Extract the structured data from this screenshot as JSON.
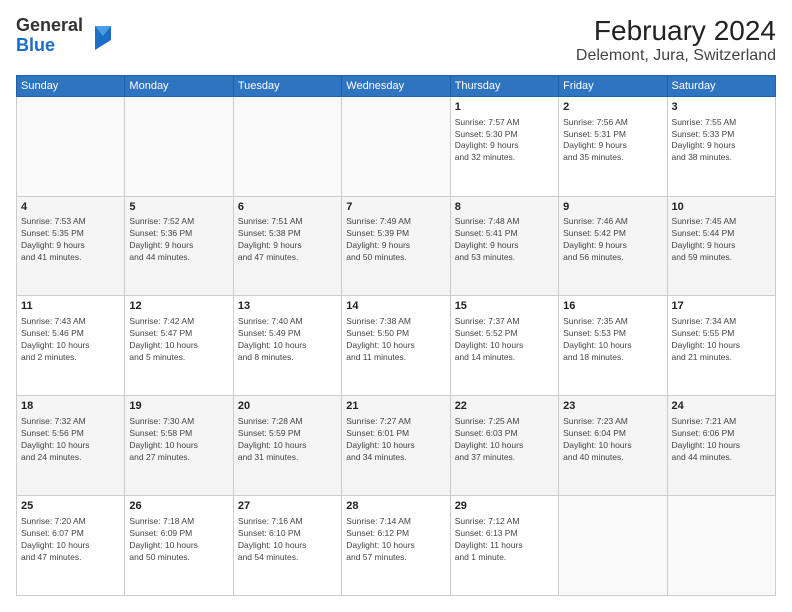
{
  "header": {
    "logo_line1": "General",
    "logo_line2": "Blue",
    "title": "February 2024",
    "subtitle": "Delemont, Jura, Switzerland"
  },
  "weekdays": [
    "Sunday",
    "Monday",
    "Tuesday",
    "Wednesday",
    "Thursday",
    "Friday",
    "Saturday"
  ],
  "weeks": [
    [
      {
        "day": "",
        "info": ""
      },
      {
        "day": "",
        "info": ""
      },
      {
        "day": "",
        "info": ""
      },
      {
        "day": "",
        "info": ""
      },
      {
        "day": "1",
        "info": "Sunrise: 7:57 AM\nSunset: 5:30 PM\nDaylight: 9 hours\nand 32 minutes."
      },
      {
        "day": "2",
        "info": "Sunrise: 7:56 AM\nSunset: 5:31 PM\nDaylight: 9 hours\nand 35 minutes."
      },
      {
        "day": "3",
        "info": "Sunrise: 7:55 AM\nSunset: 5:33 PM\nDaylight: 9 hours\nand 38 minutes."
      }
    ],
    [
      {
        "day": "4",
        "info": "Sunrise: 7:53 AM\nSunset: 5:35 PM\nDaylight: 9 hours\nand 41 minutes."
      },
      {
        "day": "5",
        "info": "Sunrise: 7:52 AM\nSunset: 5:36 PM\nDaylight: 9 hours\nand 44 minutes."
      },
      {
        "day": "6",
        "info": "Sunrise: 7:51 AM\nSunset: 5:38 PM\nDaylight: 9 hours\nand 47 minutes."
      },
      {
        "day": "7",
        "info": "Sunrise: 7:49 AM\nSunset: 5:39 PM\nDaylight: 9 hours\nand 50 minutes."
      },
      {
        "day": "8",
        "info": "Sunrise: 7:48 AM\nSunset: 5:41 PM\nDaylight: 9 hours\nand 53 minutes."
      },
      {
        "day": "9",
        "info": "Sunrise: 7:46 AM\nSunset: 5:42 PM\nDaylight: 9 hours\nand 56 minutes."
      },
      {
        "day": "10",
        "info": "Sunrise: 7:45 AM\nSunset: 5:44 PM\nDaylight: 9 hours\nand 59 minutes."
      }
    ],
    [
      {
        "day": "11",
        "info": "Sunrise: 7:43 AM\nSunset: 5:46 PM\nDaylight: 10 hours\nand 2 minutes."
      },
      {
        "day": "12",
        "info": "Sunrise: 7:42 AM\nSunset: 5:47 PM\nDaylight: 10 hours\nand 5 minutes."
      },
      {
        "day": "13",
        "info": "Sunrise: 7:40 AM\nSunset: 5:49 PM\nDaylight: 10 hours\nand 8 minutes."
      },
      {
        "day": "14",
        "info": "Sunrise: 7:38 AM\nSunset: 5:50 PM\nDaylight: 10 hours\nand 11 minutes."
      },
      {
        "day": "15",
        "info": "Sunrise: 7:37 AM\nSunset: 5:52 PM\nDaylight: 10 hours\nand 14 minutes."
      },
      {
        "day": "16",
        "info": "Sunrise: 7:35 AM\nSunset: 5:53 PM\nDaylight: 10 hours\nand 18 minutes."
      },
      {
        "day": "17",
        "info": "Sunrise: 7:34 AM\nSunset: 5:55 PM\nDaylight: 10 hours\nand 21 minutes."
      }
    ],
    [
      {
        "day": "18",
        "info": "Sunrise: 7:32 AM\nSunset: 5:56 PM\nDaylight: 10 hours\nand 24 minutes."
      },
      {
        "day": "19",
        "info": "Sunrise: 7:30 AM\nSunset: 5:58 PM\nDaylight: 10 hours\nand 27 minutes."
      },
      {
        "day": "20",
        "info": "Sunrise: 7:28 AM\nSunset: 5:59 PM\nDaylight: 10 hours\nand 31 minutes."
      },
      {
        "day": "21",
        "info": "Sunrise: 7:27 AM\nSunset: 6:01 PM\nDaylight: 10 hours\nand 34 minutes."
      },
      {
        "day": "22",
        "info": "Sunrise: 7:25 AM\nSunset: 6:03 PM\nDaylight: 10 hours\nand 37 minutes."
      },
      {
        "day": "23",
        "info": "Sunrise: 7:23 AM\nSunset: 6:04 PM\nDaylight: 10 hours\nand 40 minutes."
      },
      {
        "day": "24",
        "info": "Sunrise: 7:21 AM\nSunset: 6:06 PM\nDaylight: 10 hours\nand 44 minutes."
      }
    ],
    [
      {
        "day": "25",
        "info": "Sunrise: 7:20 AM\nSunset: 6:07 PM\nDaylight: 10 hours\nand 47 minutes."
      },
      {
        "day": "26",
        "info": "Sunrise: 7:18 AM\nSunset: 6:09 PM\nDaylight: 10 hours\nand 50 minutes."
      },
      {
        "day": "27",
        "info": "Sunrise: 7:16 AM\nSunset: 6:10 PM\nDaylight: 10 hours\nand 54 minutes."
      },
      {
        "day": "28",
        "info": "Sunrise: 7:14 AM\nSunset: 6:12 PM\nDaylight: 10 hours\nand 57 minutes."
      },
      {
        "day": "29",
        "info": "Sunrise: 7:12 AM\nSunset: 6:13 PM\nDaylight: 11 hours\nand 1 minute."
      },
      {
        "day": "",
        "info": ""
      },
      {
        "day": "",
        "info": ""
      }
    ]
  ]
}
